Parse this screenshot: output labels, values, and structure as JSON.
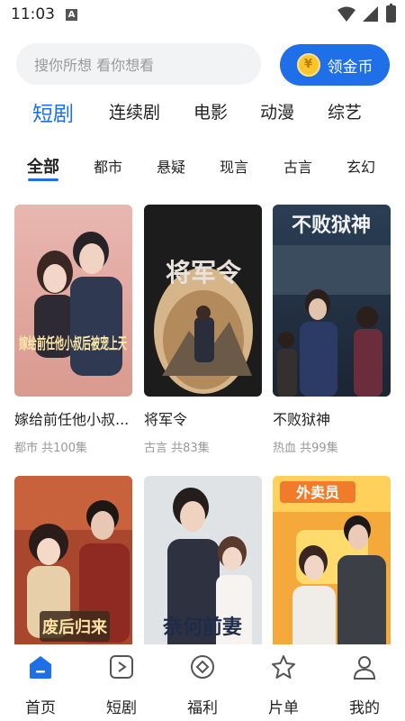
{
  "status_bar": {
    "time": "11:03",
    "notification_letter": "A"
  },
  "search": {
    "placeholder": "搜你所想 看你想看"
  },
  "coin_button": {
    "label": "领金币",
    "coin_symbol": "¥"
  },
  "main_tabs": [
    {
      "label": "短剧",
      "active": true
    },
    {
      "label": "连续剧"
    },
    {
      "label": "电影"
    },
    {
      "label": "动漫"
    },
    {
      "label": "综艺"
    }
  ],
  "sub_tabs": [
    {
      "label": "全部",
      "active": true
    },
    {
      "label": "都市"
    },
    {
      "label": "悬疑"
    },
    {
      "label": "现言"
    },
    {
      "label": "古言"
    },
    {
      "label": "玄幻"
    }
  ],
  "cards": [
    {
      "title": "嫁给前任他小叔...",
      "genre": "都市",
      "episodes": "共100集",
      "poster_text": "嫁给前任他小叔后被宠上天"
    },
    {
      "title": "将军令",
      "genre": "古言",
      "episodes": "共83集",
      "poster_text": "将军令"
    },
    {
      "title": "不败狱神",
      "genre": "热血",
      "episodes": "共99集",
      "poster_text": "不败狱神"
    },
    {
      "title": "",
      "genre": "",
      "episodes": "",
      "poster_text": "废后归来"
    },
    {
      "title": "",
      "genre": "",
      "episodes": "",
      "poster_text": "奈何前妻"
    },
    {
      "title": "",
      "genre": "",
      "episodes": "",
      "poster_text": "外卖员"
    }
  ],
  "bottom_nav": [
    {
      "label": "首页",
      "icon": "home-icon",
      "active": true
    },
    {
      "label": "短剧",
      "icon": "play-box-icon"
    },
    {
      "label": "福利",
      "icon": "diamond-badge-icon"
    },
    {
      "label": "片单",
      "icon": "star-icon"
    },
    {
      "label": "我的",
      "icon": "person-icon"
    }
  ],
  "colors": {
    "accent": "#1f6fe8",
    "coin": "#f8c52d",
    "muted": "#999999"
  }
}
